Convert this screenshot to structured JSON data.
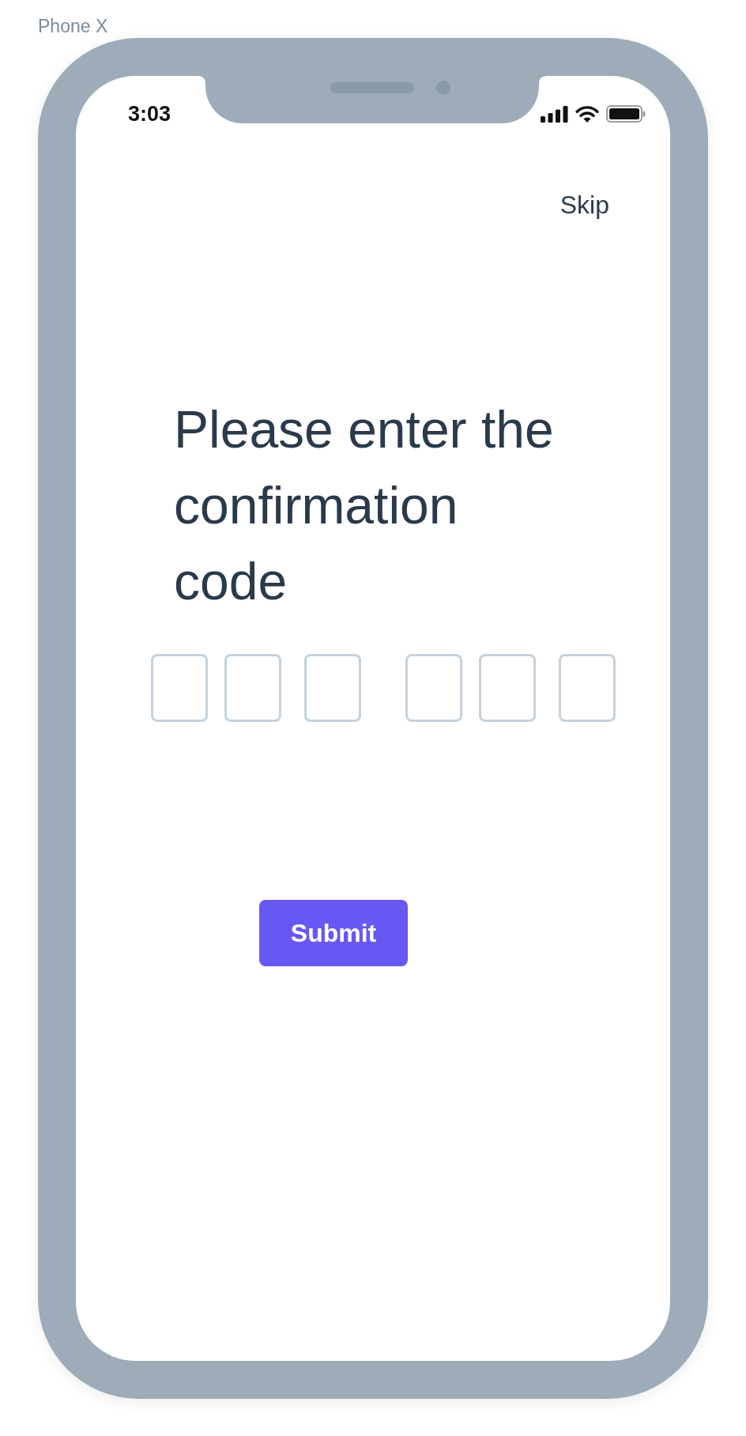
{
  "device_label": "Phone X",
  "status_bar": {
    "time": "3:03"
  },
  "skip_link": "Skip",
  "heading": "Please enter the confirmation code",
  "code_groups": [
    {
      "fields": [
        {
          "focused": false
        },
        {
          "focused": false
        },
        {
          "focused": false
        }
      ]
    },
    {
      "fields": [
        {
          "focused": false
        },
        {
          "focused": false
        },
        {
          "focused": false
        }
      ]
    }
  ],
  "submit_button": "Submit"
}
